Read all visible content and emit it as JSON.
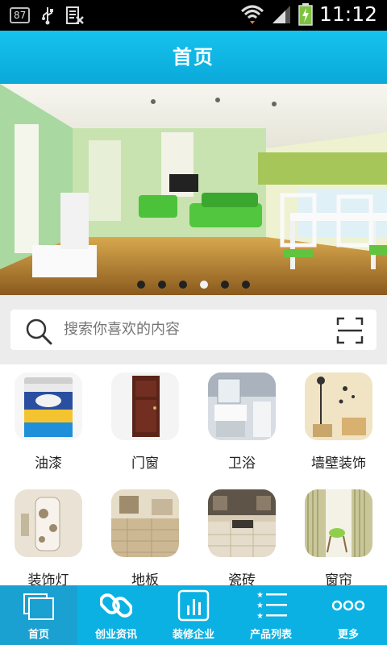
{
  "status_bar": {
    "notification_badge": "87",
    "time": "11:12",
    "icons": [
      "usb-icon",
      "sim-status-icon",
      "wifi-icon",
      "signal-icon",
      "battery-charging-icon"
    ]
  },
  "header": {
    "title": "首页"
  },
  "banner": {
    "image": "living-room-interior",
    "slide_count": 6,
    "active_slide": 4
  },
  "search": {
    "placeholder": "搜索你喜欢的内容",
    "icons": [
      "search-icon",
      "scan-icon"
    ]
  },
  "categories": [
    {
      "label": "油漆",
      "image": "paint-bucket"
    },
    {
      "label": "门窗",
      "image": "wooden-door"
    },
    {
      "label": "卫浴",
      "image": "bathroom"
    },
    {
      "label": "墙壁装饰",
      "image": "wall-decor"
    },
    {
      "label": "装饰灯",
      "image": "decorative-lamp"
    },
    {
      "label": "地板",
      "image": "floor"
    },
    {
      "label": "瓷砖",
      "image": "tiles"
    },
    {
      "label": "窗帘",
      "image": "curtains"
    }
  ],
  "bottom_nav": {
    "active_index": 0,
    "items": [
      {
        "label": "首页",
        "icon": "home-windows-icon"
      },
      {
        "label": "创业资讯",
        "icon": "link-icon"
      },
      {
        "label": "装修企业",
        "icon": "bar-chart-icon"
      },
      {
        "label": "产品列表",
        "icon": "star-list-icon"
      },
      {
        "label": "更多",
        "icon": "more-dots-icon"
      }
    ]
  },
  "colors": {
    "primary": "#0cb1e3",
    "app_bar_top": "#16c2ee",
    "nav_active": "#1ba0d2",
    "background": "#ececec"
  }
}
